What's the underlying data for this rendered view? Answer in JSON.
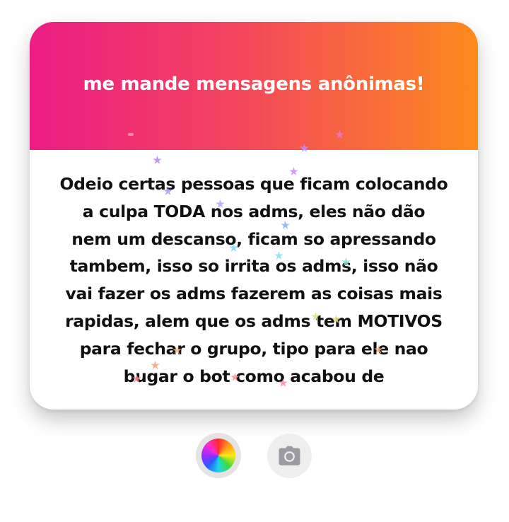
{
  "card": {
    "title": "me mande mensagens anônimas!",
    "message_lines": [
      "Odeio certas pessoas que ficam colocando",
      "a culpa TODA nos adms, eles não dão",
      "nem um descanso, ficam so apressando",
      "tambem, isso so irrita os adms, isso não",
      "vai fazer os adms fazerem as coisas mais",
      "rapidas, alem que os adms tem MOTIVOS",
      "para fechar o grupo, tipo para ele nao",
      "bugar o bot como acabou de"
    ]
  },
  "controls": {
    "color_button_icon": "color-wheel-icon",
    "camera_button_icon": "camera-icon"
  },
  "colors": {
    "header_gradient_start": "#ec1c85",
    "header_gradient_end": "#fd8a1c",
    "message_text": "#111111",
    "button_background": "#eeeeef",
    "camera_icon": "#9a9ca2"
  }
}
